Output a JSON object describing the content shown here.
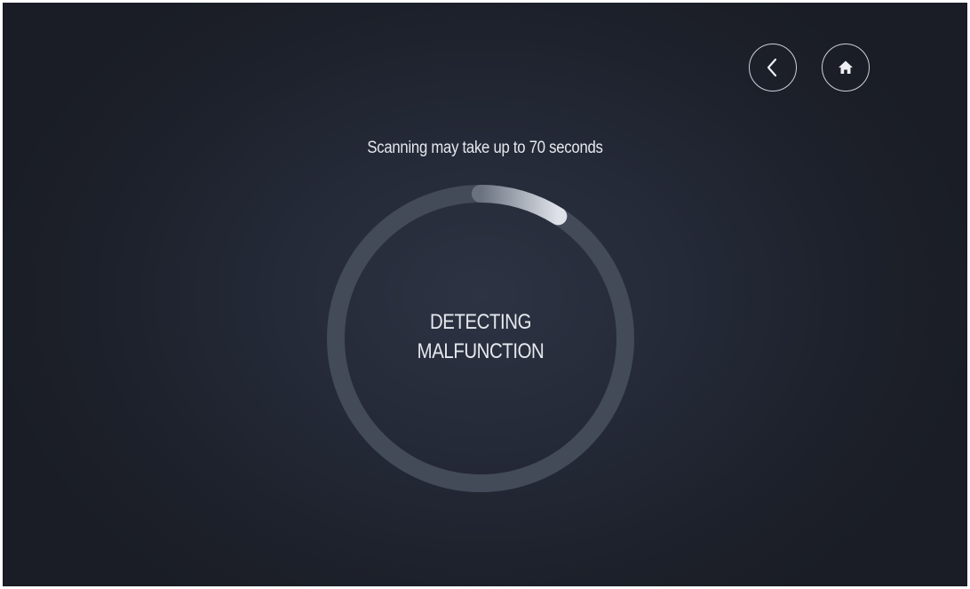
{
  "navigation": {
    "back_icon": "chevron-left-icon",
    "home_icon": "home-icon"
  },
  "scan": {
    "note": "Scanning may take up to 70 seconds",
    "status_line1": "DETECTING",
    "status_line2": "MALFUNCTION",
    "progress": 0.09
  },
  "colors": {
    "background": "#252a38",
    "ring_track": "#434a58",
    "ring_progress": "#d8dce4",
    "text": "#e6e8ee"
  }
}
